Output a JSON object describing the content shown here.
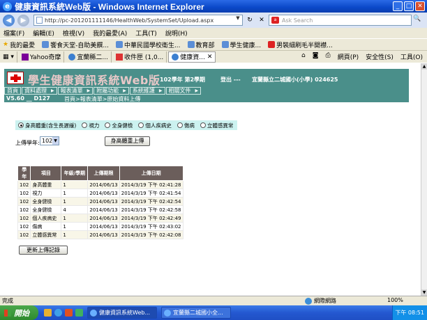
{
  "window": {
    "title": "健康資訊系統Web版 - Windows Internet Explorer"
  },
  "address": {
    "url": "http://pc-201201111146/HealthWeb/SystemSet/Upload.aspx"
  },
  "search": {
    "placeholder": "Ask Search"
  },
  "menu": [
    "檔案(F)",
    "編輯(E)",
    "檢視(V)",
    "我的最愛(A)",
    "工具(T)",
    "說明(H)"
  ],
  "favorites": {
    "label": "我的最愛",
    "items": [
      "饗食天堂-自助美饌...",
      "中華民國學校衛生...",
      "教育部",
      "學生健康...",
      "男裝細刷毛半開襟..."
    ]
  },
  "tabs": [
    "Yahoo奇摩",
    "宜蘭縣二...",
    "收件匣 (1,0...",
    "健康資..."
  ],
  "commands": [
    "網頁(P)",
    "安全性(S)",
    "工具(O)"
  ],
  "app": {
    "title": "學生健康資訊系統Web版",
    "semester": "102學年 第2學期",
    "logout": "登出 ---",
    "school": "宜蘭縣立二城國小(小學) 024625",
    "nav": [
      "首頁",
      "資料處理",
      "報表清單",
      "附屬功能",
      "系統維護",
      "相關文件"
    ],
    "version": "V5.60 __ D127",
    "breadcrumb": "首頁>報表清單>原始資料上傳"
  },
  "options": [
    {
      "label": "身高體重(含生長遲緩)",
      "selected": true
    },
    {
      "label": "視力",
      "selected": false
    },
    {
      "label": "全身健檢",
      "selected": false
    },
    {
      "label": "個人疾病史",
      "selected": false
    },
    {
      "label": "傷病",
      "selected": false
    },
    {
      "label": "立體感異常",
      "selected": false
    }
  ],
  "upload": {
    "year_label": "上傳學年:",
    "year_value": "102",
    "button": "身高體重上傳"
  },
  "table": {
    "headers": [
      "學年",
      "項目",
      "年級/學期",
      "上傳期限",
      "上傳日期"
    ],
    "rows": [
      [
        "102",
        "身高體重",
        "1",
        "2014/06/13",
        "2014/3/19 下午 02:41:28"
      ],
      [
        "102",
        "視力",
        "1",
        "2014/06/13",
        "2014/3/19 下午 02:41:54"
      ],
      [
        "102",
        "全身健檢",
        "1",
        "2014/06/13",
        "2014/3/19 下午 02:42:54"
      ],
      [
        "102",
        "全身健檢",
        "4",
        "2014/06/13",
        "2014/3/19 下午 02:42:58"
      ],
      [
        "102",
        "個人疾病史",
        "1",
        "2014/06/13",
        "2014/3/19 下午 02:42:49"
      ],
      [
        "102",
        "傷病",
        "1",
        "2014/06/13",
        "2014/3/19 下午 02:43:02"
      ],
      [
        "102",
        "立體感異常",
        "1",
        "2014/06/13",
        "2014/3/19 下午 02:42:08"
      ]
    ]
  },
  "refresh_button": "更新上傳記錄",
  "status": {
    "left": "完成",
    "zone": "網際網路",
    "zoom": "100%"
  },
  "taskbar": {
    "start": "開始",
    "items": [
      "健康資訊系統Web...",
      "宜蘭縣二城國小全..."
    ],
    "clock": "下午 08:51"
  }
}
